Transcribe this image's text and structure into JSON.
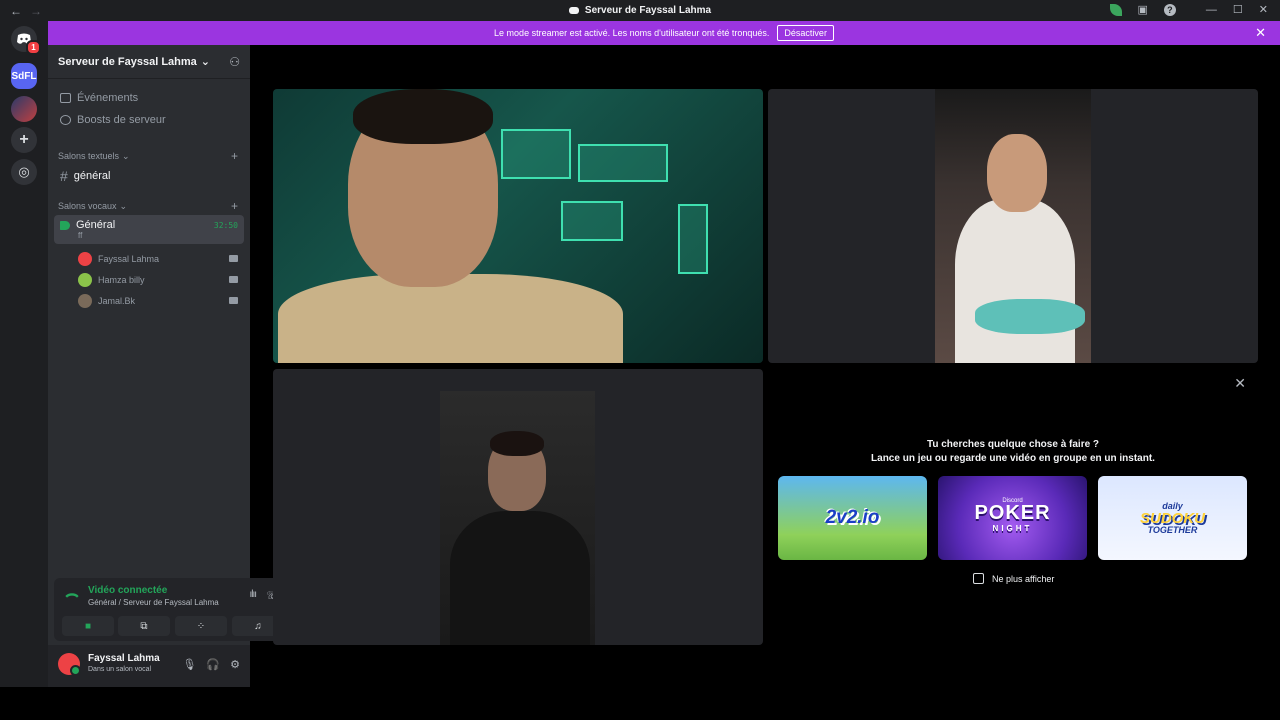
{
  "window": {
    "title": "Serveur de Fayssal Lahma"
  },
  "banner": {
    "text": "Le mode streamer est activé. Les noms d'utilisateur ont été tronqués.",
    "button_label": "Désactiver"
  },
  "rail": {
    "home_badge": "1",
    "server_initials": "SdFL"
  },
  "sidebar": {
    "server_name": "Serveur de Fayssal Lahma",
    "links": [
      {
        "label": "Événements"
      },
      {
        "label": "Boosts de serveur"
      }
    ],
    "text_section": "Salons textuels",
    "text_channels": [
      {
        "name": "général"
      }
    ],
    "voice_section": "Salons vocaux",
    "voice_channel": {
      "name": "Général",
      "timer": "32:50",
      "subtitle": "ff"
    },
    "members": [
      {
        "name": "Fayssal Lahma",
        "color": "#ed4245"
      },
      {
        "name": "Hamza billy",
        "color": "#8bc34a"
      },
      {
        "name": "Jamal.Bk",
        "color": "#7a6a5a"
      }
    ]
  },
  "voice_panel": {
    "status": "Vidéo connectée",
    "location": "Général / Serveur de Fayssal Lahma"
  },
  "user_panel": {
    "name": "Fayssal Lahma",
    "status": "Dans un salon vocal"
  },
  "activity": {
    "question": "Tu cherches quelque chose à faire ?",
    "subtitle": "Lance un jeu ou regarde une vidéo en groupe en un instant.",
    "cards": [
      {
        "title": "2v2.io"
      },
      {
        "brand": "Discord",
        "title": "POKER",
        "subtitle": "NIGHT"
      },
      {
        "small": "daily",
        "title": "SUDOKU",
        "subtitle": "TOGETHER"
      }
    ],
    "dont_show": "Ne plus afficher"
  },
  "colors": {
    "accent_purple": "#9b35e0",
    "online_green": "#23a55a",
    "blurple": "#5865f2"
  }
}
